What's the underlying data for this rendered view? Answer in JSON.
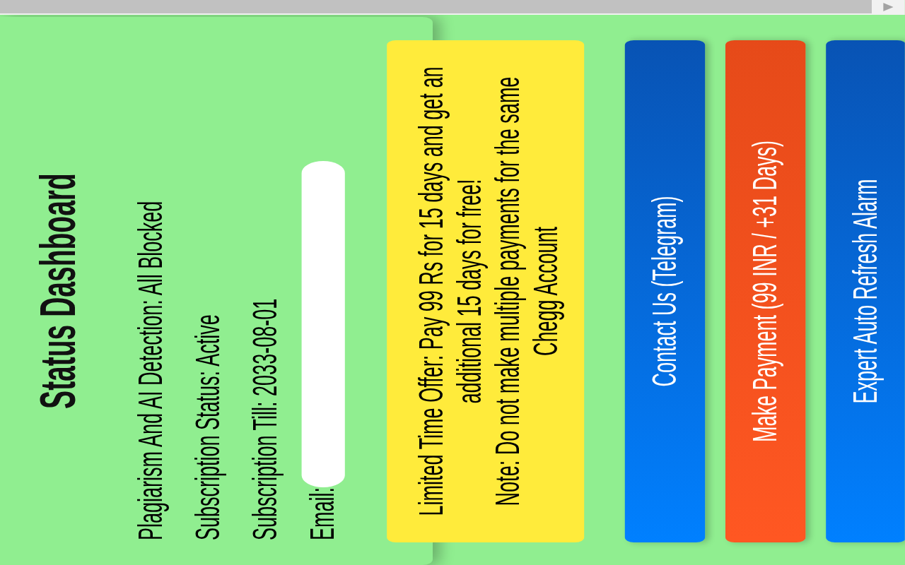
{
  "status_dashboard": {
    "title": "Status Dashboard",
    "lines": [
      "Plagiarism And AI Detection: All Blocked",
      "Subscription Status: Active",
      "Subscription Till: 2033-08-01"
    ],
    "email": {
      "label": "Email:",
      "redacted": true
    }
  },
  "offer": {
    "text": "Limited Time Offer: Pay 99 Rs for 15 days and get an additional 15 days for free!",
    "note": "Note: Do not make multiple payments for the same Chegg Account"
  },
  "buttons": [
    {
      "label": "Contact Us (Telegram)",
      "kind": "primary"
    },
    {
      "label": "Make Payment (99 INR / +31 Days)",
      "kind": "accent"
    },
    {
      "label": "Expert Auto Refresh Alarm",
      "kind": "primary"
    }
  ]
}
